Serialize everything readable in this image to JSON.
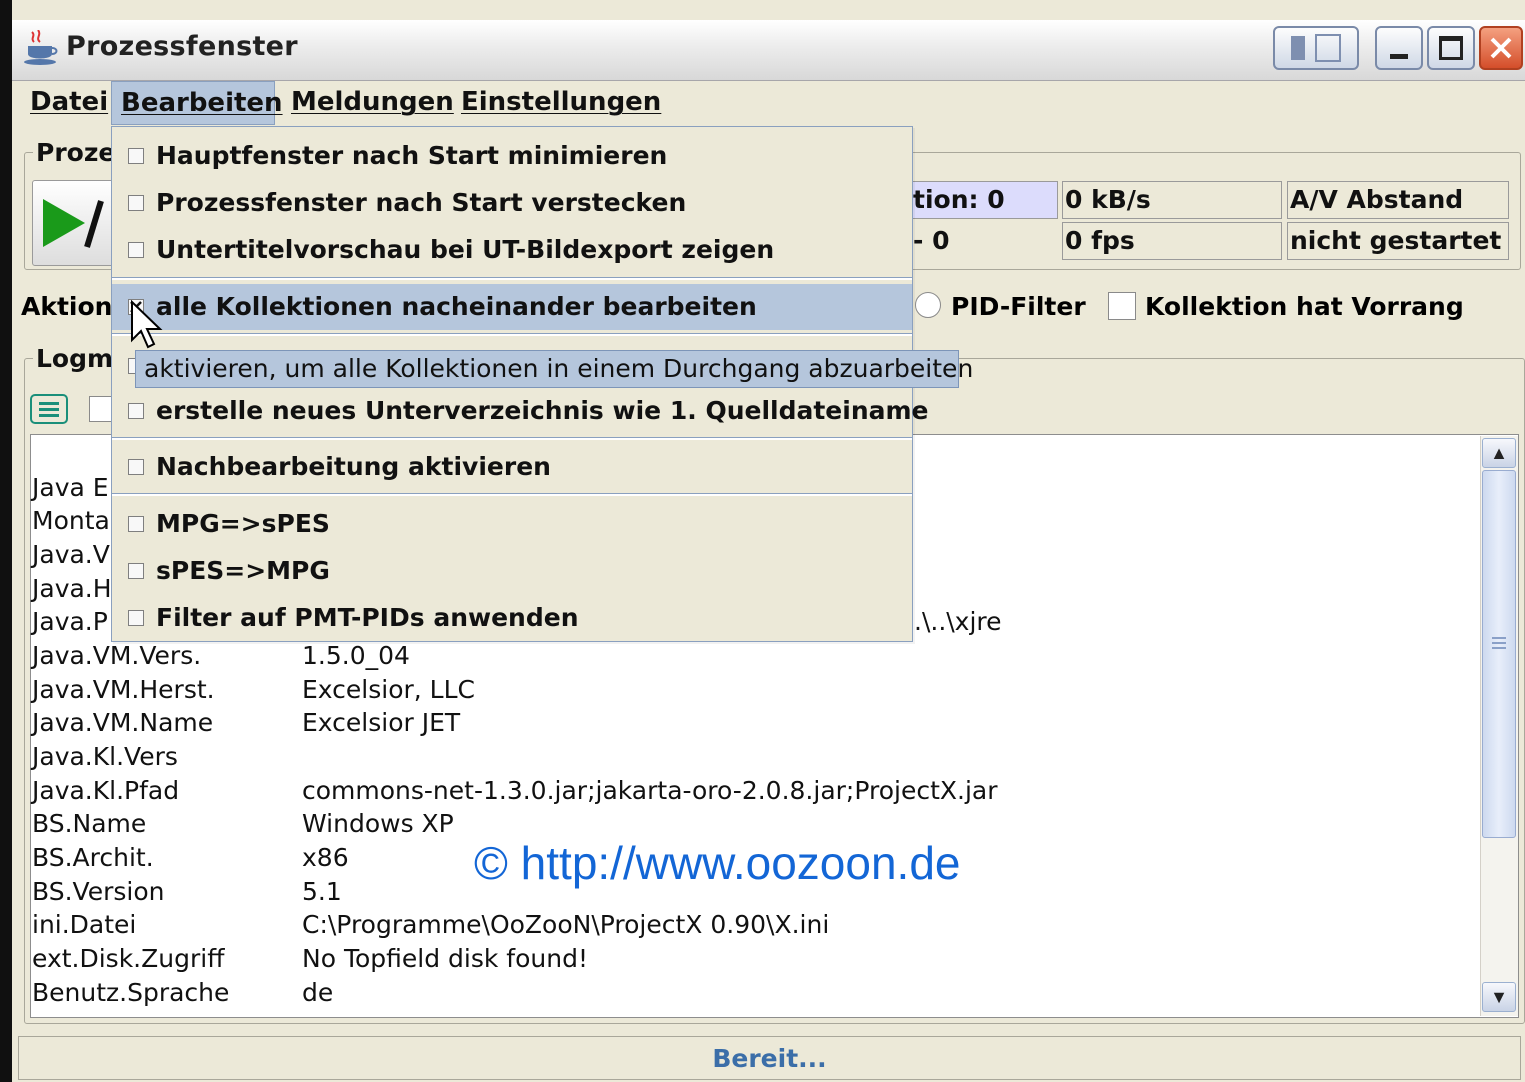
{
  "window": {
    "title": "Prozessfenster"
  },
  "menubar": {
    "items": [
      {
        "label": "Datei",
        "mnemonic": "D"
      },
      {
        "label": "Bearbeiten",
        "mnemonic": "B"
      },
      {
        "label": "Meldungen",
        "mnemonic": "M"
      },
      {
        "label": "Einstellungen",
        "mnemonic": "E"
      }
    ]
  },
  "process_group": {
    "label": "Proze",
    "play_icon": "play-pause-icon",
    "fields": {
      "collection": "tion: 0",
      "collection_row2": "- 0",
      "rate": "0 kB/s",
      "fps": "0 fps",
      "av_label": "A/V Abstand",
      "av_value": "nicht gestartet"
    }
  },
  "action_row": {
    "label": "Aktion:",
    "pid_filter": "PID-Filter",
    "collection_priority": "Kollektion hat Vorrang"
  },
  "log_group": {
    "label": "Logm"
  },
  "log": {
    "visible_keys_partial": [
      "Java E",
      "Monta",
      "Java.V",
      "Java.H",
      "Java.P"
    ],
    "java_p_tail": ".\\..\\xjre",
    "rows": [
      {
        "key": "Java.VM.Vers.",
        "value": "1.5.0_04"
      },
      {
        "key": "Java.VM.Herst.",
        "value": "Excelsior, LLC"
      },
      {
        "key": "Java.VM.Name",
        "value": "Excelsior JET"
      },
      {
        "key": "Java.Kl.Vers",
        "value": ""
      },
      {
        "key": "Java.Kl.Pfad",
        "value": "commons-net-1.3.0.jar;jakarta-oro-2.0.8.jar;ProjectX.jar"
      },
      {
        "key": "BS.Name",
        "value": "Windows XP"
      },
      {
        "key": "BS.Archit.",
        "value": "x86"
      },
      {
        "key": "BS.Version",
        "value": "5.1"
      },
      {
        "key": "ini.Datei",
        "value": "C:\\Programme\\OoZooN\\ProjectX 0.90\\X.ini"
      },
      {
        "key": "ext.Disk.Zugriff",
        "value": "No Topfield disk found!"
      },
      {
        "key": "Benutz.Sprache",
        "value": "de"
      }
    ]
  },
  "watermark": "© http://www.oozoon.de",
  "status": "Bereit...",
  "dropdown": {
    "items": [
      {
        "label": "Hauptfenster nach Start minimieren",
        "checked": false
      },
      {
        "label": "Prozessfenster nach Start verstecken",
        "checked": false
      },
      {
        "label": "Untertitelvorschau bei UT-Bildexport zeigen",
        "checked": false
      },
      {
        "label": "alle Kollektionen nacheinander bearbeiten",
        "checked": true,
        "selected": true
      },
      {
        "label": "erstelle neues Unterverzeichnis wie 1. Quelldateiname",
        "checked": false
      },
      {
        "label": "Nachbearbeitung aktivieren",
        "checked": false
      },
      {
        "label": "MPG=>sPES",
        "checked": false
      },
      {
        "label": "sPES=>MPG",
        "checked": false
      },
      {
        "label": "Filter auf PMT-PIDs anwenden",
        "checked": false
      }
    ],
    "tooltip": "aktivieren, um alle Kollektionen in einem Durchgang abzuarbeiten"
  },
  "colors": {
    "window_bg": "#ece9d8",
    "menu_highlight": "#b5c6dc",
    "watermark": "#1366d6",
    "status_text": "#3b6ea8",
    "play_green": "#1a9a1a"
  }
}
